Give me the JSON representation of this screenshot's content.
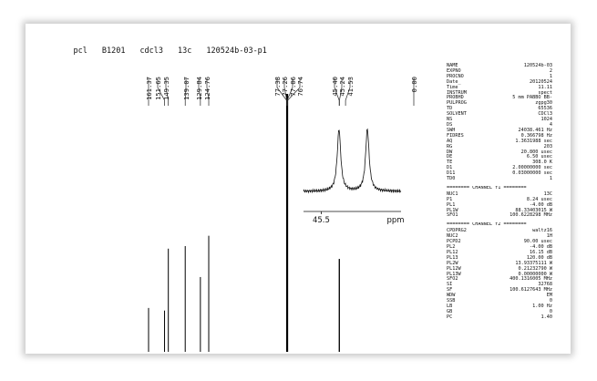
{
  "header": {
    "items": [
      "pcl",
      "B1201",
      "cdcl3",
      "13c",
      "120524b-03-p1"
    ]
  },
  "chart_data": {
    "type": "line",
    "title": "",
    "xlabel": "",
    "ylabel": "",
    "peak_labels": [
      "161.37",
      "151.65",
      "149.35",
      "139.07",
      "129.84",
      "124.76",
      "77.38",
      "77.26",
      "77.06",
      "76.74",
      "45.40",
      "45.24",
      "41.53",
      "0.00"
    ],
    "peaks": [
      {
        "ppm": 161.37,
        "intensity": 0.17
      },
      {
        "ppm": 151.65,
        "intensity": 0.16
      },
      {
        "ppm": 149.35,
        "intensity": 0.4
      },
      {
        "ppm": 139.07,
        "intensity": 0.41
      },
      {
        "ppm": 129.84,
        "intensity": 0.29
      },
      {
        "ppm": 124.76,
        "intensity": 0.45
      },
      {
        "ppm": 77.06,
        "intensity": 1.0
      },
      {
        "ppm": 45.4,
        "intensity": 0.36
      },
      {
        "ppm": 45.24,
        "intensity": 0.36
      }
    ],
    "inset": {
      "tick_label": "45.5",
      "unit": "ppm",
      "peaks": [
        {
          "ppm": 45.4,
          "intensity": 1.0
        },
        {
          "ppm": 45.24,
          "intensity": 1.0
        }
      ]
    }
  },
  "params": {
    "acq": [
      [
        "NAME",
        "120524b-03"
      ],
      [
        "EXPNO",
        "2"
      ],
      [
        "PROCNO",
        "1"
      ],
      [
        "Date_",
        "20120524"
      ],
      [
        "Time",
        "11.11"
      ],
      [
        "INSTRUM",
        "spect"
      ],
      [
        "PROBHD",
        "5 mm PABBO BB-"
      ],
      [
        "PULPROG",
        "zgpg30"
      ],
      [
        "TD",
        "65536"
      ],
      [
        "SOLVENT",
        "CDCl3"
      ],
      [
        "NS",
        "1024"
      ],
      [
        "DS",
        "4"
      ],
      [
        "SWH",
        "24038.461 Hz"
      ],
      [
        "FIDRES",
        "0.366798 Hz"
      ],
      [
        "AQ",
        "1.3631988 sec"
      ],
      [
        "RG",
        "203"
      ],
      [
        "DW",
        "20.800 usec"
      ],
      [
        "DE",
        "6.50 usec"
      ],
      [
        "TE",
        "308.0 K"
      ],
      [
        "D1",
        "2.00000000 sec"
      ],
      [
        "D11",
        "0.03000000 sec"
      ],
      [
        "TD0",
        "1"
      ]
    ],
    "f1_title": "======== CHANNEL f1 ========",
    "f1": [
      [
        "NUC1",
        "13C"
      ],
      [
        "P1",
        "8.24 usec"
      ],
      [
        "PL1",
        "-4.00 dB"
      ],
      [
        "PL1W",
        "88.33403015 W"
      ],
      [
        "SFO1",
        "100.6228298 MHz"
      ]
    ],
    "f2_title": "======== CHANNEL f2 ========",
    "f2": [
      [
        "CPDPRG2",
        "waltz16"
      ],
      [
        "NUC2",
        "1H"
      ],
      [
        "PCPD2",
        "90.00 usec"
      ],
      [
        "PL2",
        "-4.00 dB"
      ],
      [
        "PL12",
        "16.15 dB"
      ],
      [
        "PL13",
        "120.00 dB"
      ],
      [
        "PL2W",
        "13.93375111 W"
      ],
      [
        "PL12W",
        "0.21232790 W"
      ],
      [
        "PL13W",
        "0.00000000 W"
      ],
      [
        "SFO2",
        "400.1316005 MHz"
      ],
      [
        "SI",
        "32768"
      ],
      [
        "SF",
        "100.6127643 MHz"
      ],
      [
        "WDW",
        "EM"
      ],
      [
        "SSB",
        "0"
      ],
      [
        "LB",
        "1.00 Hz"
      ],
      [
        "GB",
        "0"
      ],
      [
        "PC",
        "1.40"
      ]
    ]
  }
}
